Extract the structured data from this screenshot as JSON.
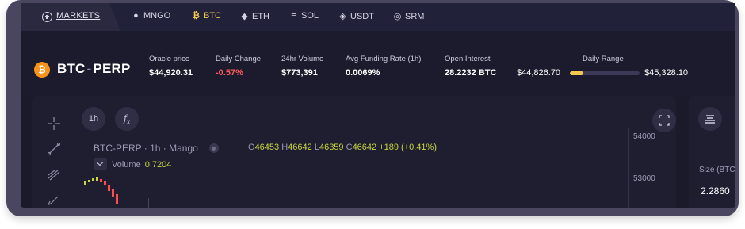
{
  "topbar": {
    "markets_label": "MARKETS",
    "markets": [
      {
        "label": "MNGO",
        "icon": "mango-icon",
        "active": false
      },
      {
        "label": "BTC",
        "icon": "bitcoin-icon",
        "active": true
      },
      {
        "label": "ETH",
        "icon": "ethereum-icon",
        "active": false
      },
      {
        "label": "SOL",
        "icon": "solana-icon",
        "active": false
      },
      {
        "label": "USDT",
        "icon": "tether-icon",
        "active": false
      },
      {
        "label": "SRM",
        "icon": "serum-icon",
        "active": false
      }
    ]
  },
  "header": {
    "coin_glyph": "₿",
    "base": "BTC",
    "separator": "-",
    "quote": "PERP",
    "stats": {
      "oracle_price": {
        "label": "Oracle price",
        "value": "$44,920.31"
      },
      "daily_change": {
        "label": "Daily Change",
        "value": "-0.57%"
      },
      "volume": {
        "label": "24hr Volume",
        "value": "$773,391"
      },
      "funding": {
        "label": "Avg Funding Rate (1h)",
        "value": "0.0069%"
      },
      "open_interest": {
        "label": "Open Interest",
        "value": "28.2232 BTC"
      }
    },
    "daily_range": {
      "label": "Daily Range",
      "low": "$44,826.70",
      "high": "$45,328.10",
      "position": 0.19
    }
  },
  "chart": {
    "interval": "1h",
    "indicator_glyph": "f",
    "title": "BTC-PERP · 1h · Mango",
    "ohlc": {
      "o_label": "O",
      "o": "46453",
      "h_label": "H",
      "h": "46642",
      "l_label": "L",
      "l": "46359",
      "c_label": "C",
      "c": "46642",
      "change": "+189 (+0.41%)"
    },
    "volume_label": "Volume",
    "volume_value": "0.7204",
    "axis_ticks": [
      "54000",
      "53000"
    ],
    "colors": {
      "up": "#c9d53f",
      "down": "#ff4d4d",
      "accent": "#f2c94c"
    }
  },
  "orderbook": {
    "size_label": "Size (BTC",
    "size_value": "2.2860"
  }
}
